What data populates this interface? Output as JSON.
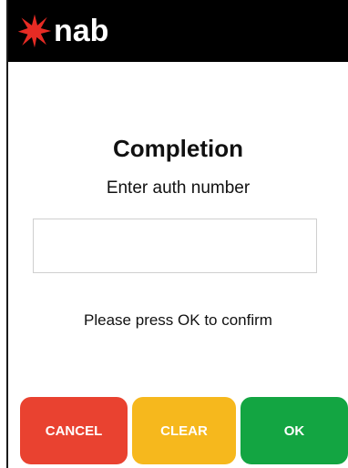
{
  "header": {
    "brand": "nab",
    "logo_icon": "nab-star-icon",
    "background": "#000000",
    "star_color": "#e62b24"
  },
  "main": {
    "title": "Completion",
    "subtitle": "Enter auth number",
    "auth_input": {
      "value": "",
      "placeholder": ""
    },
    "prompt": "Please press OK to confirm"
  },
  "buttons": {
    "cancel_label": "CANCEL",
    "clear_label": "CLEAR",
    "ok_label": "OK",
    "cancel_color": "#e94230",
    "clear_color": "#f6b81d",
    "ok_color": "#13a542"
  }
}
